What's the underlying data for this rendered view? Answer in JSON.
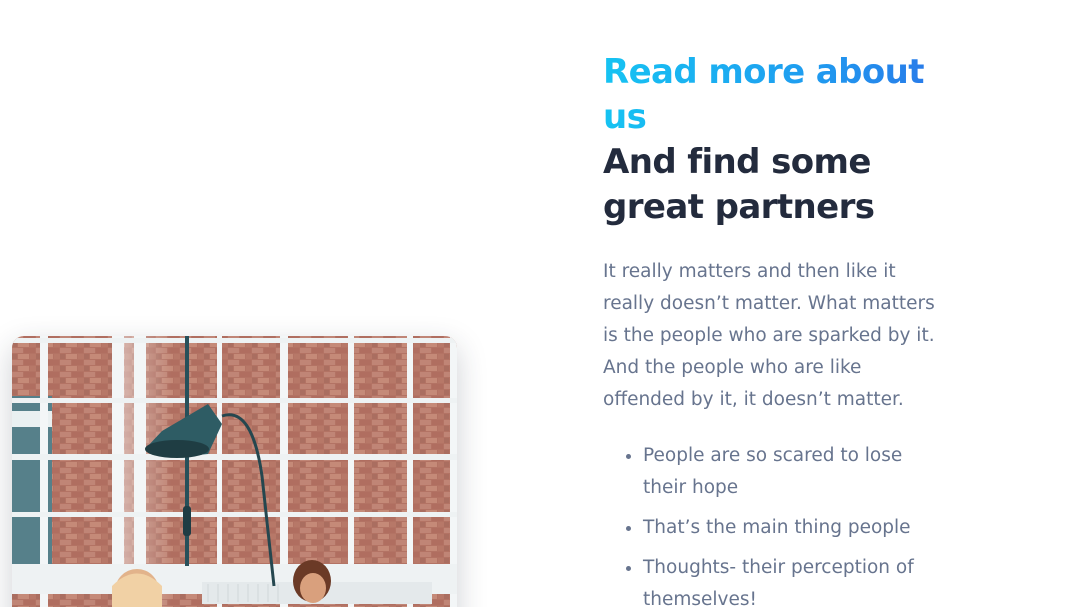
{
  "section": {
    "heading_accent": "Read more about us",
    "heading_main": "And find some great partners",
    "intro": "It really matters and then like it really doesn’t matter. What matters is the people who are sparked by it. And the people who are like offended by it, it doesn’t matter.",
    "bullets": [
      "People are so scared to lose their hope",
      "That’s the main thing people",
      "Thoughts- their perception of themselves!"
    ]
  },
  "photo": {
    "subject": "office-photo",
    "colors": {
      "brick": "#b06a58",
      "window_frame": "#f4f7f8",
      "lamp": "#2f5f66"
    }
  },
  "colors": {
    "accent_start": "#16c3f2",
    "accent_end": "#2a76e8",
    "heading": "#232b3d",
    "body_text": "#67748e"
  }
}
